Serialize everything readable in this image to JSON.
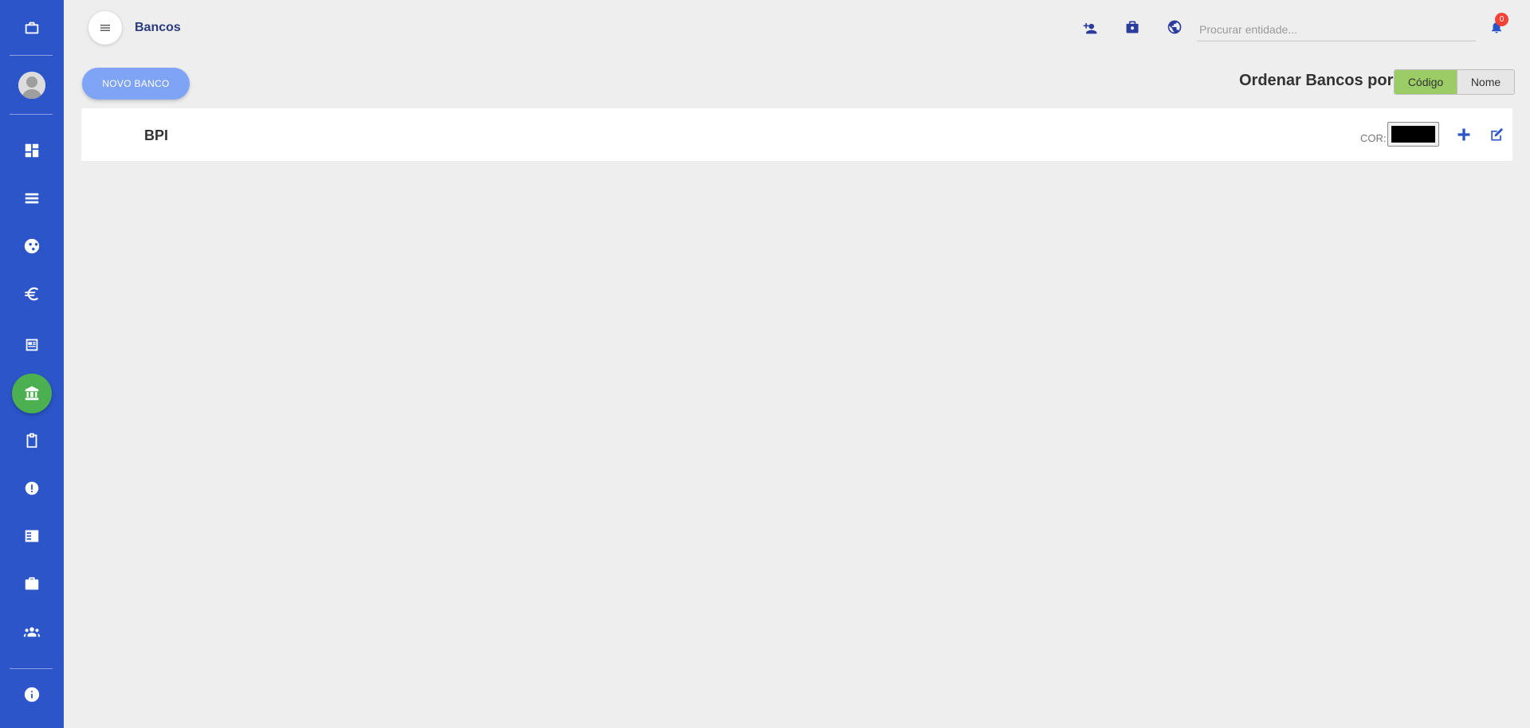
{
  "header": {
    "title": "Bancos",
    "search_placeholder": "Procurar entidade...",
    "notification_count": "0"
  },
  "toolbar": {
    "new_button_label": "NOVO BANCO",
    "order_label": "Ordenar Bancos por:",
    "order_options": [
      "Código",
      "Nome"
    ],
    "order_selected": "Código"
  },
  "banks": [
    {
      "name": "BPI",
      "color_label": "COR:",
      "color": "#000000"
    }
  ],
  "sidebar": {
    "active_item": "bank-icon",
    "items": [
      "dashboard-icon",
      "list-icon",
      "group-icon",
      "euro-icon",
      "news-icon",
      "bank-icon",
      "clipboard-icon",
      "alert-icon",
      "checklist-icon",
      "briefcase-icon",
      "people-icon",
      "info-icon"
    ]
  },
  "colors": {
    "sidebar": "#2b55c9",
    "active": "#4caf50",
    "primary_button": "#7fa3f5",
    "selected_toggle": "#9ccc65",
    "badge": "#f44336"
  }
}
